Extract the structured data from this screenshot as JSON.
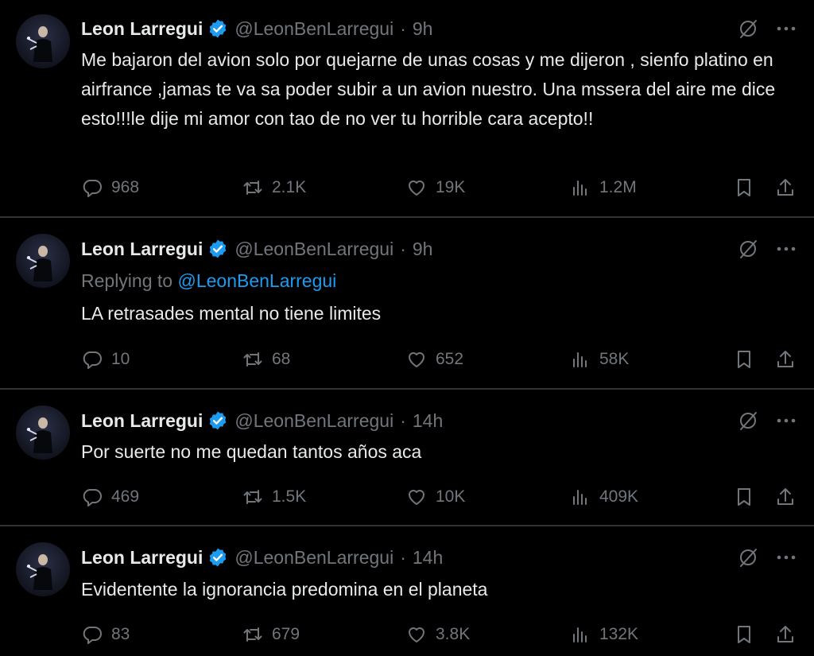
{
  "colors": {
    "background": "#000000",
    "text": "#e7e9ea",
    "muted": "#71767b",
    "accent": "#1d9bf0",
    "divider": "#2f3336"
  },
  "icons": {
    "verified": "verified-badge-icon",
    "grok": "grok-icon",
    "more": "more-options-icon",
    "reply": "reply-icon",
    "retweet": "retweet-icon",
    "like": "heart-icon",
    "views": "views-icon",
    "bookmark": "bookmark-icon",
    "share": "share-icon"
  },
  "tweets": [
    {
      "name": "Leon Larregui",
      "handle": "@LeonBenLarregui",
      "separator": "·",
      "time": "9h",
      "text": "Me bajaron del avion solo por quejarne de unas cosas y me dijeron , sienfo platino en airfrance ,jamas te va sa poder subir a un avion nuestro. Una mssera del aire me dice esto!!!le dije mi amor con tao de no ver tu horrible cara acepto!!",
      "replies": "968",
      "retweets": "2.1K",
      "likes": "19K",
      "views": "1.2M"
    },
    {
      "name": "Leon Larregui",
      "handle": "@LeonBenLarregui",
      "separator": "·",
      "time": "9h",
      "replying_prefix": "Replying to",
      "replying_to": "@LeonBenLarregui",
      "text": "LA retrasades mental no tiene limites",
      "replies": "10",
      "retweets": "68",
      "likes": "652",
      "views": "58K"
    },
    {
      "name": "Leon Larregui",
      "handle": "@LeonBenLarregui",
      "separator": "·",
      "time": "14h",
      "text": "Por suerte no me quedan tantos años aca",
      "replies": "469",
      "retweets": "1.5K",
      "likes": "10K",
      "views": "409K"
    },
    {
      "name": "Leon Larregui",
      "handle": "@LeonBenLarregui",
      "separator": "·",
      "time": "14h",
      "text": "Evidentente la ignorancia predomina en el planeta",
      "replies": "83",
      "retweets": "679",
      "likes": "3.8K",
      "views": "132K"
    }
  ]
}
